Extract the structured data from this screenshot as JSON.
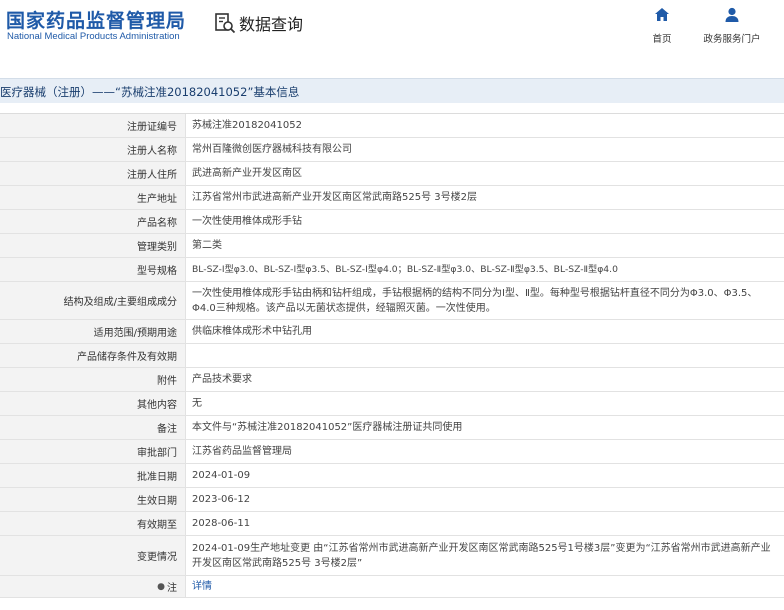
{
  "header": {
    "logo_cn": "国家药品监督管理局",
    "logo_en": "National Medical Products Administration",
    "query_label": "数据查询",
    "nav": [
      {
        "label": "首页",
        "icon": "home-icon"
      },
      {
        "label": "政务服务门户",
        "icon": "user-icon"
      }
    ]
  },
  "breadcrumb": {
    "text": "医疗器械（注册）——“苏械注准20182041052”基本信息"
  },
  "rows": [
    {
      "label": "注册证编号",
      "value": "苏械注准20182041052"
    },
    {
      "label": "注册人名称",
      "value": "常州百隆微创医疗器械科技有限公司"
    },
    {
      "label": "注册人住所",
      "value": "武进高新产业开发区南区"
    },
    {
      "label": "生产地址",
      "value": "江苏省常州市武进高新产业开发区南区常武南路525号 3号楼2层"
    },
    {
      "label": "产品名称",
      "value": "一次性使用椎体成形手钻"
    },
    {
      "label": "管理类别",
      "value": "第二类"
    },
    {
      "label": "型号规格",
      "value": "BL-SZ-Ⅰ型φ3.0、BL-SZ-Ⅰ型φ3.5、BL-SZ-Ⅰ型φ4.0；BL-SZ-Ⅱ型φ3.0、BL-SZ-Ⅱ型φ3.5、BL-SZ-Ⅱ型φ4.0"
    },
    {
      "label": "结构及组成/主要组成成分",
      "value": "一次性使用椎体成形手钻由柄和钻杆组成，手钻根据柄的结构不同分为Ⅰ型、Ⅱ型。每种型号根据钻杆直径不同分为Φ3.0、Φ3.5、Φ4.0三种规格。该产品以无菌状态提供，经辐照灭菌。一次性使用。"
    },
    {
      "label": "适用范围/预期用途",
      "value": "供临床椎体成形术中钻孔用"
    },
    {
      "label": "产品储存条件及有效期",
      "value": ""
    },
    {
      "label": "附件",
      "value": "产品技术要求"
    },
    {
      "label": "其他内容",
      "value": "无"
    },
    {
      "label": "备注",
      "value": "本文件与“苏械注准20182041052”医疗器械注册证共同使用"
    },
    {
      "label": "审批部门",
      "value": "江苏省药品监督管理局"
    },
    {
      "label": "批准日期",
      "value": "2024-01-09"
    },
    {
      "label": "生效日期",
      "value": "2023-06-12"
    },
    {
      "label": "有效期至",
      "value": "2028-06-11"
    },
    {
      "label": "变更情况",
      "value": "2024-01-09生产地址变更 由“江苏省常州市武进高新产业开发区南区常武南路525号1号楼3层”变更为“江苏省常州市武进高新产业开发区南区常武南路525号 3号楼2层”"
    },
    {
      "label": "注",
      "value": "详情",
      "icon": "pin-icon"
    }
  ],
  "colors": {
    "brand": "#1f5aa8",
    "titlebar_bg": "#e7eef6",
    "label_bg": "#f3f3f3"
  }
}
